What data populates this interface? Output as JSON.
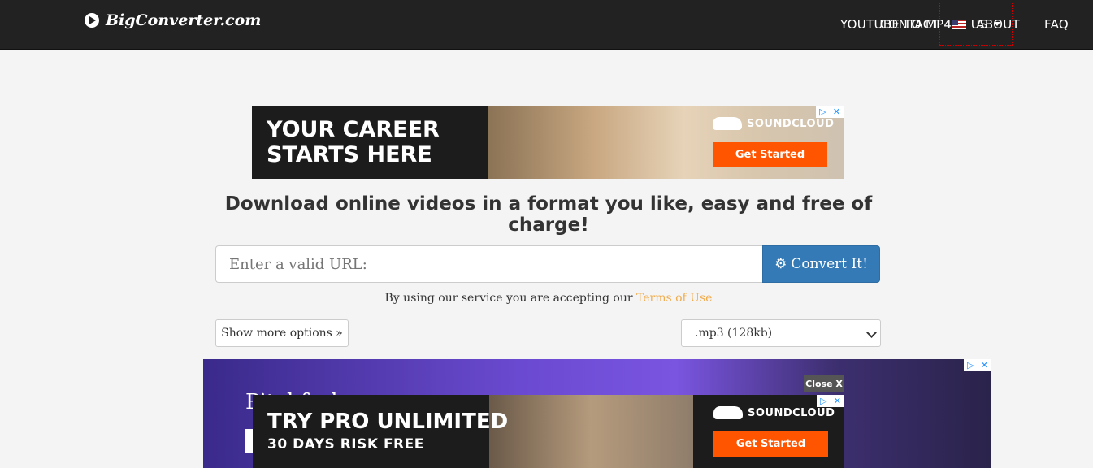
{
  "header": {
    "brand": "BigConverter.com",
    "nav": [
      "YOUTUBE TO MP4",
      "ABOUT",
      "FAQ",
      "CONTACT"
    ],
    "language": "US"
  },
  "ad_top": {
    "headline": "YOUR CAREER STARTS HERE",
    "sponsor": "SOUNDCLOUD",
    "cta": "Get Started"
  },
  "main": {
    "headline": "Download online videos in a format you like, easy and free of charge!",
    "url_placeholder": "Enter a valid URL:",
    "convert_label": "Convert It!",
    "terms_prefix": "By using our service you are accepting our",
    "terms_link": "Terms of Use",
    "more_options": "Show more options »",
    "format_selected": ".mp3 (128kb)"
  },
  "ad_bottom": {
    "brand": "Pitchfork",
    "close": "Close X",
    "headline1": "TRY PRO UNLIMITED",
    "headline2": "30 DAYS RISK FREE",
    "sponsor": "SOUNDCLOUD",
    "cta": "Get Started"
  }
}
